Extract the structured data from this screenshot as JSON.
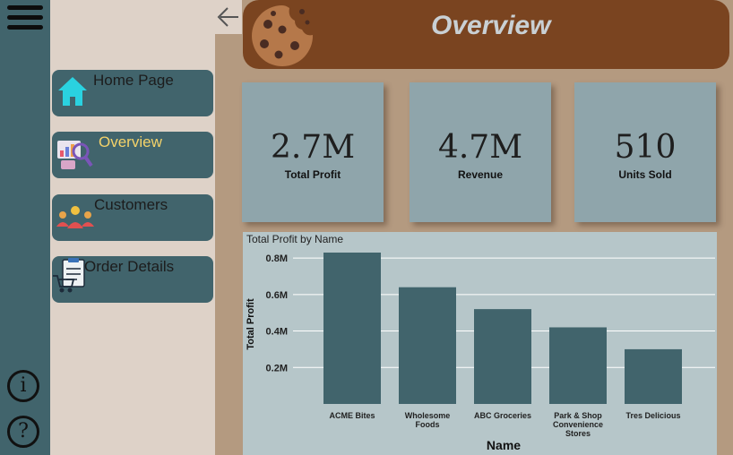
{
  "page": {
    "title": "Overview"
  },
  "nav": {
    "items": [
      {
        "label": "Home Page",
        "icon": "home-icon",
        "active": false
      },
      {
        "label": "Overview",
        "icon": "analytics-icon",
        "active": true
      },
      {
        "label": "Customers",
        "icon": "people-icon",
        "active": false
      },
      {
        "label": "Order Details",
        "icon": "clipboard-cart-icon",
        "active": false
      }
    ],
    "active_color": "#f5d36a"
  },
  "kpis": [
    {
      "value": "2.7M",
      "label": "Total Profit"
    },
    {
      "value": "4.7M",
      "label": "Revenue"
    },
    {
      "value": "510",
      "label": "Units Sold"
    }
  ],
  "colors": {
    "rail": "#41646c",
    "header": "#7a4420",
    "card": "#8fa5ab",
    "bar": "#41646c",
    "chart_bg": "#b6c6c9",
    "nav_pane": "#ded2c8",
    "canvas": "#b49a80"
  },
  "chart_data": {
    "type": "bar",
    "title": "Total Profit by Name",
    "xlabel": "Name",
    "ylabel": "Total Profit",
    "categories": [
      [
        "ACME Bites"
      ],
      [
        "Wholesome",
        "Foods"
      ],
      [
        "ABC Groceries"
      ],
      [
        "Park & Shop",
        "Convenience",
        "Stores"
      ],
      [
        "Tres Delicious"
      ]
    ],
    "values": [
      0.83,
      0.64,
      0.52,
      0.42,
      0.3
    ],
    "ylim": [
      0,
      0.83
    ],
    "yticks": [
      0.2,
      0.4,
      0.6,
      0.8
    ],
    "ytick_labels": [
      "0.2M",
      "0.4M",
      "0.6M",
      "0.8M"
    ],
    "grid": true,
    "legend": "none"
  }
}
